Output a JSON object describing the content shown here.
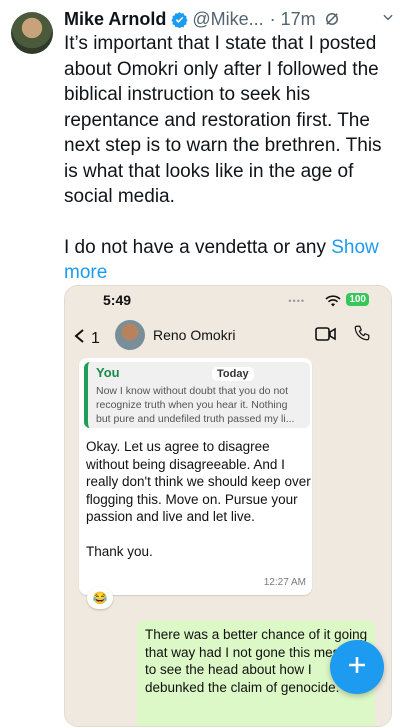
{
  "tweet": {
    "author_name": "Mike Arnold",
    "handle": "@Mike...",
    "time": "· 17m",
    "paragraph1": "It’s important that I state that I posted about Omokri only after I followed the biblical instruction to seek his repentance and restoration first. The next step is to warn the brethren. This is what that looks like in the age of social media.",
    "paragraph2": "I do not have a vendetta or any",
    "show_more": "Show more"
  },
  "screenshot": {
    "clock": "5:49",
    "status_dots": "••••",
    "battery": "100",
    "back_count": "1",
    "contact_name": "Reno Omokri",
    "quote_author": "You",
    "date_badge": "Today",
    "quote_lines": [
      "Now I know without doubt that you do not",
      "recognize truth when you hear it. Nothing",
      "but pure and undefiled truth passed my li..."
    ],
    "incoming_message": "Okay. Let us agree to disagree without being disagreeable. And I really don't think we should keep over flogging this. Move on. Pursue your passion and live and let live.",
    "incoming_thanks": "Thank you.",
    "incoming_time": "12:27 AM",
    "reaction": "😂",
    "outgoing_message": "There was a better chance of it going that way had I not gone this message to see the head about how I debunked the claim of genocide."
  },
  "icons": [
    "verified-badge-icon",
    "grok-icon",
    "chevron-down-icon",
    "back-chevron-icon",
    "video-call-icon",
    "phone-icon",
    "wifi-icon",
    "plus-icon"
  ],
  "colors": {
    "accent": "#1d9bf0",
    "verified": "#1d9bf0",
    "wa_green_bubble": "#dcf8c6",
    "wa_quote_bar": "#1e9e56"
  }
}
